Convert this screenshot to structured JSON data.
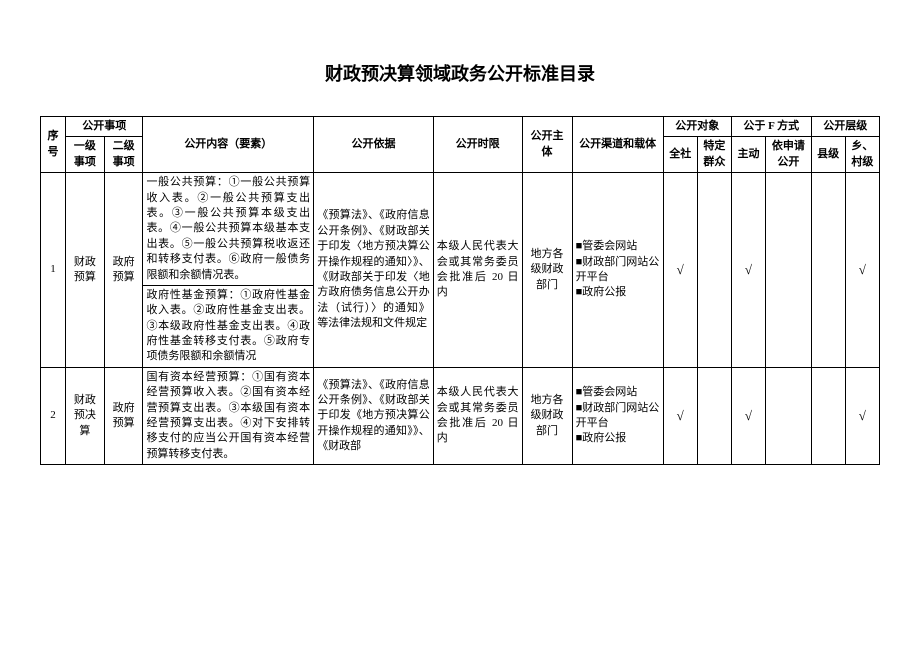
{
  "title": "财政预决算领域政务公开标准目录",
  "headers": {
    "seq": "序号",
    "matter": "公开事项",
    "matter_l1": "一级事项",
    "matter_l2": "二级事项",
    "content": "公开内容（要素）",
    "basis": "公开依据",
    "timing": "公开时限",
    "subject": "公开主体",
    "channel": "公开渠道和载体",
    "audience": "公开对象",
    "aud_all": "全社",
    "aud_spec": "特定群众",
    "method": "公于 F 方式",
    "method_active": "主动",
    "method_req": "依申请公开",
    "level": "公开层级",
    "level_county": "县级",
    "level_village": "乡、村级"
  },
  "rows": [
    {
      "seq": "1",
      "l1": "财政预算",
      "l2": "政府预算",
      "content_a": "一般公共预算：①一般公共预算收入表。②一般公共预算支出表。③一般公共预算本级支出表。④一般公共预算本级基本支出表。⑤一般公共预算税收返还和转移支付表。⑥政府一般债务限额和余额情况表。",
      "content_b": "政府性基金预算：①政府性基金收入表。②政府性基金支出表。③本级政府性基金支出表。④政府性基金转移支付表。⑤政府专项债务限额和余额情况",
      "basis": "《预算法》、《政府信息公开条例》、《财政部关于印发〈地方预决算公开操作规程的通知〉》、《财政部关于印发〈地方政府债务信息公开办法（试行）〉的通知》等法律法规和文件规定",
      "timing": "本级人民代表大会或其常务委员会批准后 20 日内",
      "subject": "地方各级财政部门",
      "channel": "■管委会网站\n■财政部门网站公开平台\n■政府公报",
      "aud_all": "√",
      "aud_spec": "",
      "m_active": "√",
      "m_req": "",
      "lv_county": "",
      "lv_village": "√"
    },
    {
      "seq": "2",
      "l1": "财政预决算",
      "l2": "政府预算",
      "content": "国有资本经营预算：①国有资本经营预算收入表。②国有资本经营预算支出表。③本级国有资本经营预算支出表。④对下安排转移支付的应当公开国有资本经营预算转移支付表。",
      "basis": "《预算法》、《政府信息公开条例》、《财政部关于印发《地方预决算公开操作规程的通知》》、《财政部",
      "timing": "本级人民代表大会或其常务委员会批准后 20 日内",
      "subject": "地方各级财政部门",
      "channel": "■管委会网站\n■财政部门网站公开平台\n■政府公报",
      "aud_all": "√",
      "aud_spec": "",
      "m_active": "√",
      "m_req": "",
      "lv_county": "",
      "lv_village": "√"
    }
  ]
}
